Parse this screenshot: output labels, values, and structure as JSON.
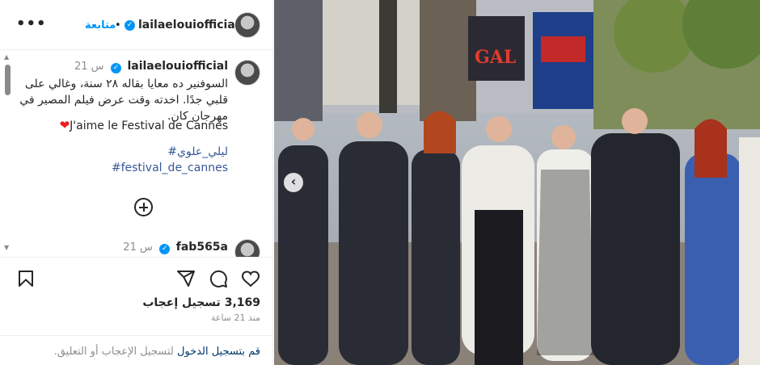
{
  "header": {
    "username": "lailaelouiofficial",
    "follow_label": "متابعة",
    "separator": "•",
    "more_label": "•••",
    "verified_mark": "✓"
  },
  "comment_main": {
    "username": "lailaelouiofficial",
    "time": "21 س",
    "text": "السوفنير ده معايا بقاله ٢٨ سنة، وغالي على قلبي جدًا. اخدته وقت عرض فيلم المصير في مهرجان كان.",
    "text_en": "J'aime le Festival de Cannes",
    "heart": "❤",
    "hashtags": [
      "#ليلي_علوي",
      "#festival_de_cannes"
    ]
  },
  "comment_second": {
    "username": "fab565a",
    "time": "21 س"
  },
  "icons": {
    "more": "more-icon",
    "verified": "verified-icon",
    "bookmark": "bookmark-icon",
    "share": "share-icon",
    "comment": "comment-icon",
    "like": "heart-icon",
    "load_more": "plus-circle-icon",
    "carousel_prev": "chevron-left-icon"
  },
  "stats": {
    "likes": "3,169 تسجيل إعجاب",
    "time_ago": "منذ 21 ساعة"
  },
  "login_prompt": {
    "link": "قم بتسجيل الدخول",
    "rest": " لتسجيل الإعجاب أو التعليق."
  },
  "carousel": {
    "prev_label": "‹"
  },
  "colors": {
    "accent": "#0095f6",
    "text": "#262626",
    "muted": "#8e8e8e",
    "link": "#385898",
    "heart": "#ed1c24"
  }
}
